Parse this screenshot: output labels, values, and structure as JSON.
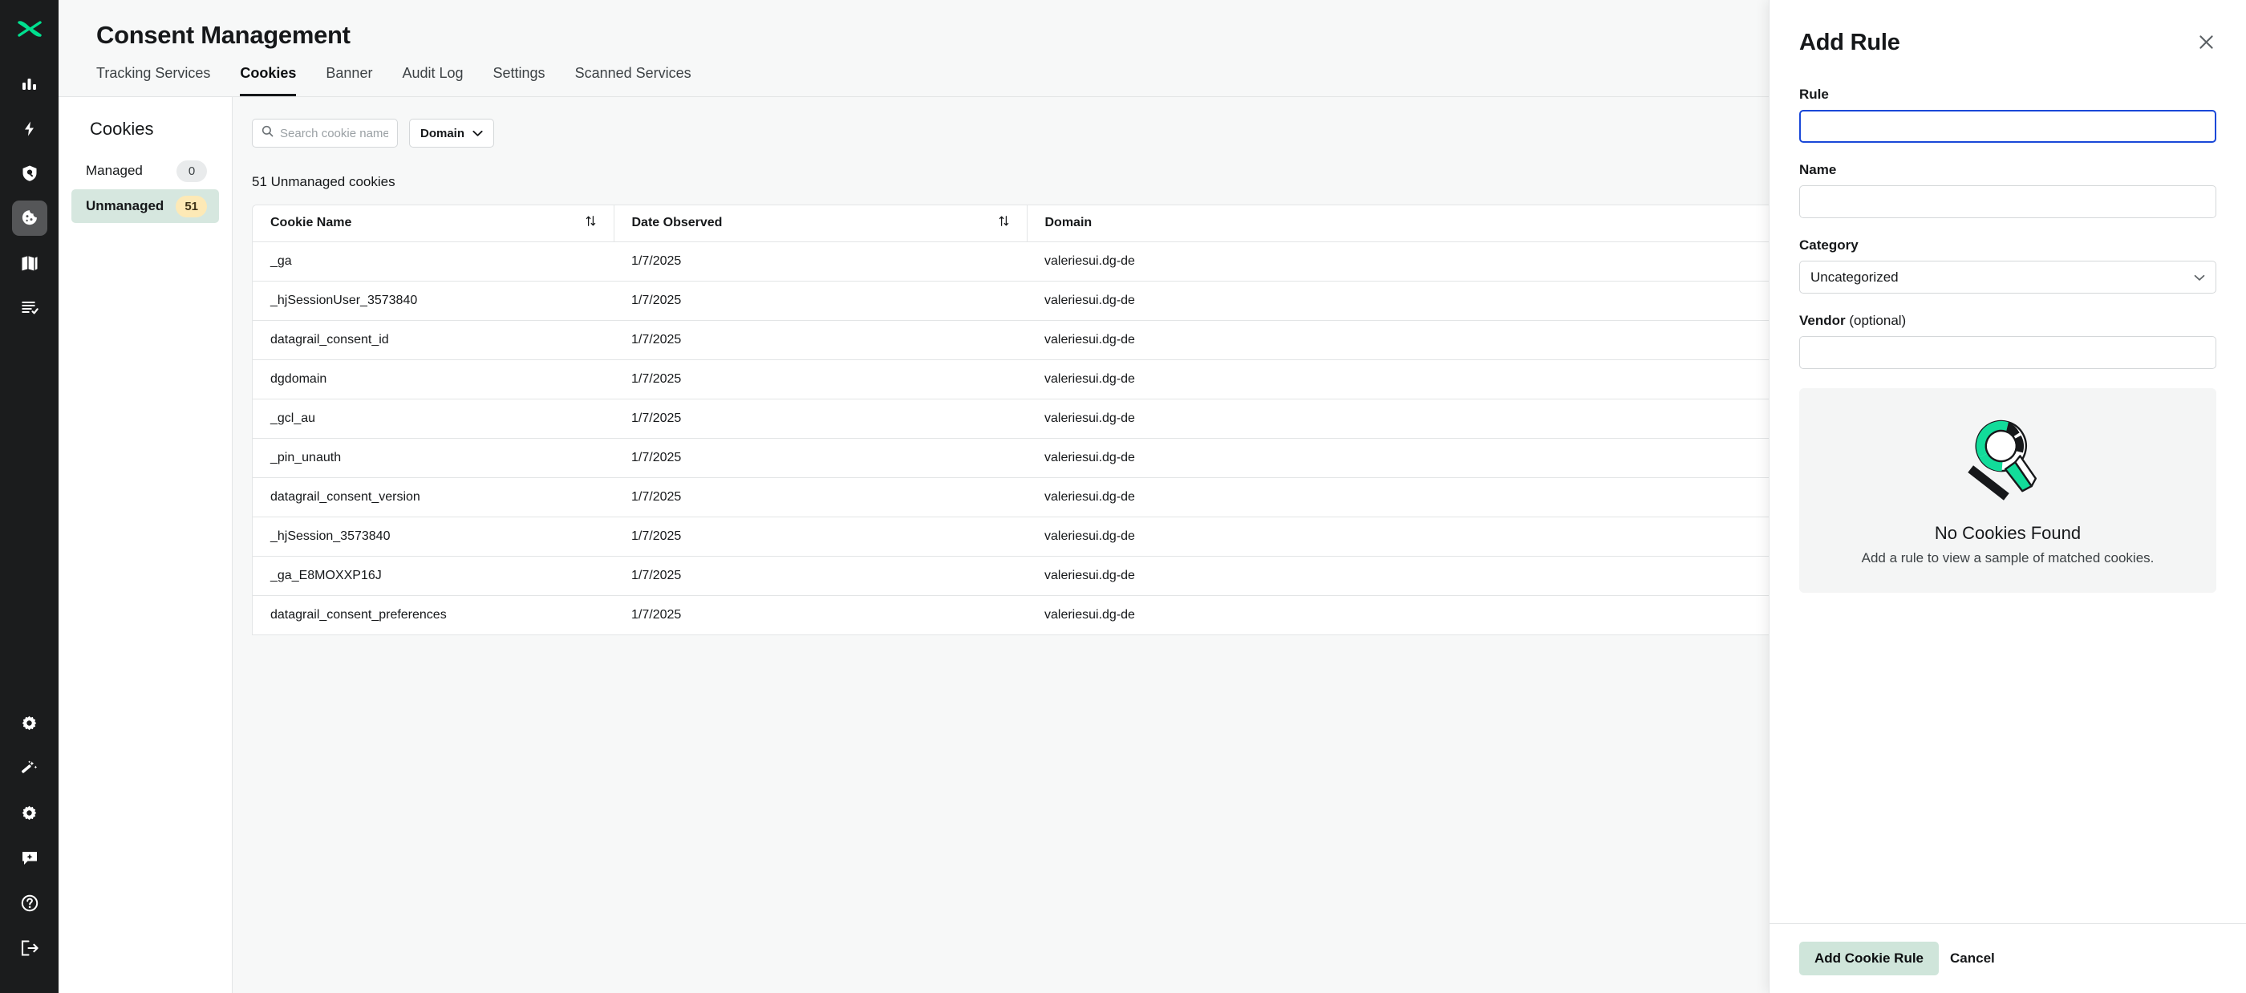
{
  "rail": {
    "logo": "datagrail-logo",
    "logo_color": "#00e08f",
    "top_items": [
      {
        "icon": "bar-chart-icon",
        "name": "analytics",
        "active": false
      },
      {
        "icon": "lightning-bolt-icon",
        "name": "automation",
        "active": false
      },
      {
        "icon": "shield-search-icon",
        "name": "risk-monitoring",
        "active": false
      },
      {
        "icon": "cookie-icon",
        "name": "consent-management",
        "active": true
      },
      {
        "icon": "book-icon",
        "name": "data-map",
        "active": false
      },
      {
        "icon": "document-list-icon",
        "name": "reports",
        "active": false
      }
    ],
    "bottom_items": [
      {
        "icon": "gear-icon",
        "name": "integrations"
      },
      {
        "icon": "magic-wand-icon",
        "name": "assistant"
      },
      {
        "icon": "gear-icon",
        "name": "settings"
      },
      {
        "icon": "chat-sparkle-icon",
        "name": "feedback"
      },
      {
        "icon": "help-circle-icon",
        "name": "help"
      },
      {
        "icon": "logout-icon",
        "name": "logout"
      }
    ]
  },
  "header": {
    "title": "Consent Management",
    "tabs": [
      {
        "label": "Tracking Services",
        "active": false
      },
      {
        "label": "Cookies",
        "active": true
      },
      {
        "label": "Banner",
        "active": false
      },
      {
        "label": "Audit Log",
        "active": false
      },
      {
        "label": "Settings",
        "active": false
      },
      {
        "label": "Scanned Services",
        "active": false
      }
    ]
  },
  "subnav": {
    "title": "Cookies",
    "items": [
      {
        "label": "Managed",
        "count": "0",
        "active": false,
        "badge_style": "neutral"
      },
      {
        "label": "Unmanaged",
        "count": "51",
        "active": true,
        "badge_style": "warn"
      }
    ]
  },
  "toolbar": {
    "search_placeholder": "Search cookie names",
    "search_value": "",
    "search_icon": "search-icon",
    "filter_label": "Domain",
    "filter_icon": "chevron-down-icon"
  },
  "table": {
    "count_text": "51 Unmanaged cookies",
    "columns": [
      {
        "label": "Cookie Name",
        "sortable": true,
        "sort_icon": "sort-icon"
      },
      {
        "label": "Date Observed",
        "sortable": true,
        "sort_icon": "sort-icon"
      },
      {
        "label": "Domain",
        "sortable": false
      }
    ],
    "rows": [
      {
        "name": "_ga",
        "date": "1/7/2025",
        "domain": "valeriesui.dg-de"
      },
      {
        "name": "_hjSessionUser_3573840",
        "date": "1/7/2025",
        "domain": "valeriesui.dg-de"
      },
      {
        "name": "datagrail_consent_id",
        "date": "1/7/2025",
        "domain": "valeriesui.dg-de"
      },
      {
        "name": "dgdomain",
        "date": "1/7/2025",
        "domain": "valeriesui.dg-de"
      },
      {
        "name": "_gcl_au",
        "date": "1/7/2025",
        "domain": "valeriesui.dg-de"
      },
      {
        "name": "_pin_unauth",
        "date": "1/7/2025",
        "domain": "valeriesui.dg-de"
      },
      {
        "name": "datagrail_consent_version",
        "date": "1/7/2025",
        "domain": "valeriesui.dg-de"
      },
      {
        "name": "_hjSession_3573840",
        "date": "1/7/2025",
        "domain": "valeriesui.dg-de"
      },
      {
        "name": "_ga_E8MOXXP16J",
        "date": "1/7/2025",
        "domain": "valeriesui.dg-de"
      },
      {
        "name": "datagrail_consent_preferences",
        "date": "1/7/2025",
        "domain": "valeriesui.dg-de"
      }
    ]
  },
  "panel": {
    "title": "Add Rule",
    "close_icon": "close-icon",
    "fields": {
      "rule": {
        "label": "Rule",
        "value": "",
        "focused": true
      },
      "name": {
        "label": "Name",
        "value": ""
      },
      "category": {
        "label": "Category",
        "value": "Uncategorized",
        "chevron": "chevron-down-icon"
      },
      "vendor": {
        "label": "Vendor",
        "optional_suffix": " (optional)",
        "value": ""
      }
    },
    "empty_state": {
      "illustration": "magnifying-glass-illustration",
      "title": "No Cookies Found",
      "subtitle": "Add a rule to view a sample of matched cookies."
    },
    "footer": {
      "primary_label": "Add Cookie Rule",
      "cancel_label": "Cancel"
    }
  },
  "colors": {
    "brand_green": "#00e08f",
    "accent_mint": "#cfe5da",
    "focus_blue": "#1a48d8",
    "badge_yellow": "#fde9b6",
    "rail_dark": "#1b1c1d"
  }
}
